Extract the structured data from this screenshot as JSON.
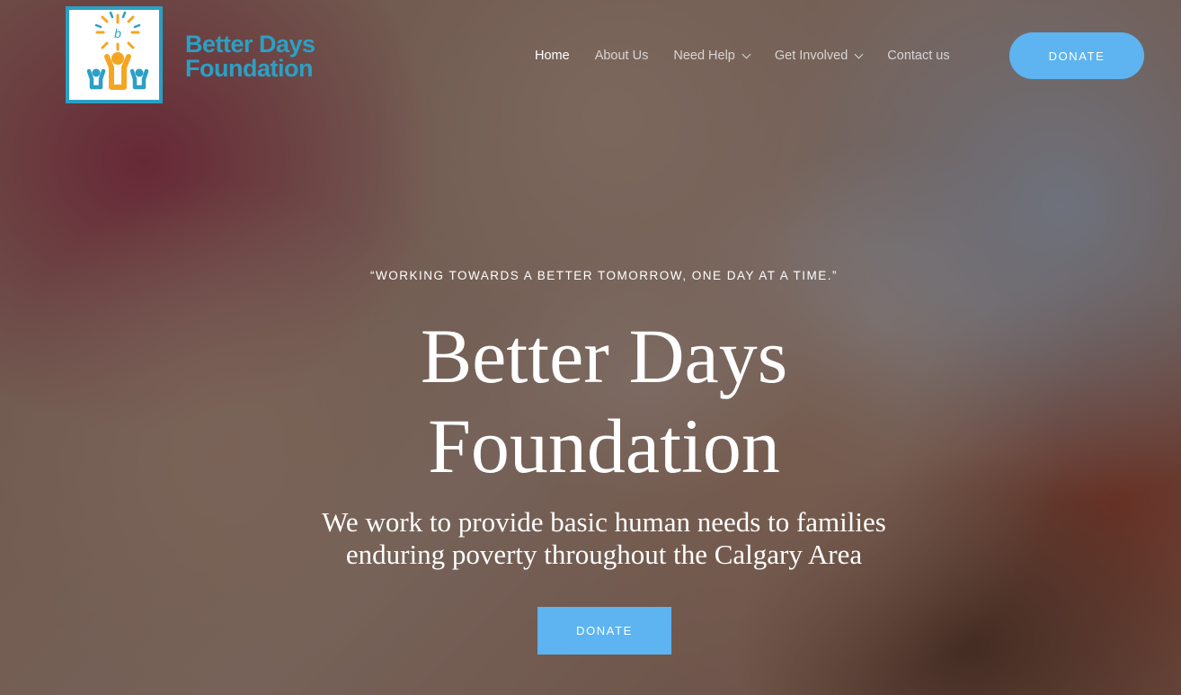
{
  "header": {
    "logo_text_line1": "Better Days",
    "logo_text_line2": "Foundation"
  },
  "nav": {
    "items": [
      {
        "label": "Home",
        "active": true,
        "dropdown": false
      },
      {
        "label": "About Us",
        "active": false,
        "dropdown": false
      },
      {
        "label": "Need Help",
        "active": false,
        "dropdown": true
      },
      {
        "label": "Get Involved",
        "active": false,
        "dropdown": true
      },
      {
        "label": "Contact us",
        "active": false,
        "dropdown": false
      }
    ],
    "donate_label": "DONATE"
  },
  "hero": {
    "tagline": "“WORKING TOWARDS A BETTER TOMORROW, ONE DAY AT A TIME.”",
    "title_line1": "Better Days",
    "title_line2": "Foundation",
    "subtitle_line1": "We work to provide basic human needs to families",
    "subtitle_line2": "enduring poverty throughout the Calgary Area",
    "donate_label": "DONATE"
  },
  "colors": {
    "accent_blue": "#5db4f0",
    "logo_teal": "#2ba0c4",
    "logo_orange": "#f4a623"
  },
  "icons": [
    "sun-logo-icon",
    "people-logo-icon",
    "chevron-down-icon"
  ]
}
